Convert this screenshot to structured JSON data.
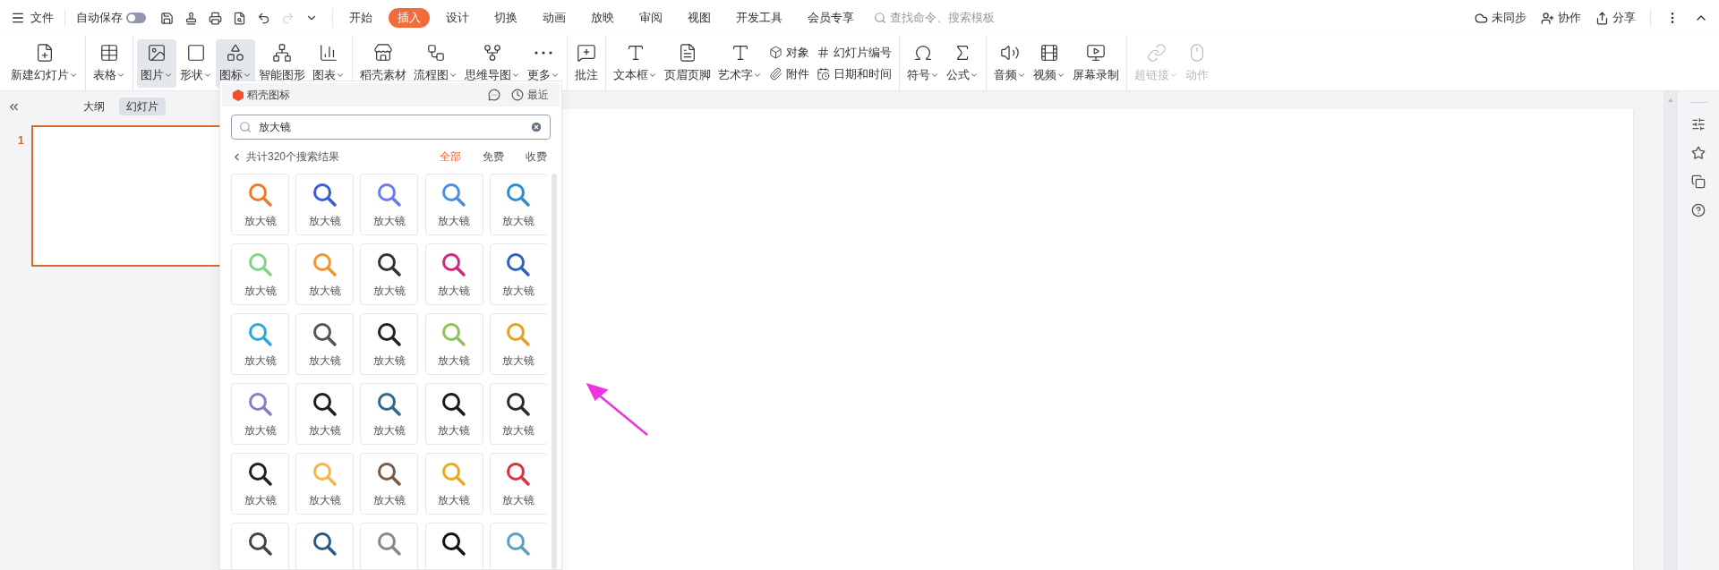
{
  "topbar": {
    "file_menu": "文件",
    "autosave": {
      "label": "自动保存",
      "on": false
    },
    "tabs": [
      {
        "label": "开始",
        "selected": false
      },
      {
        "label": "插入",
        "selected": true
      },
      {
        "label": "设计",
        "selected": false
      },
      {
        "label": "切换",
        "selected": false
      },
      {
        "label": "动画",
        "selected": false
      },
      {
        "label": "放映",
        "selected": false
      },
      {
        "label": "审阅",
        "selected": false
      },
      {
        "label": "视图",
        "selected": false
      },
      {
        "label": "开发工具",
        "selected": false
      },
      {
        "label": "会员专享",
        "selected": false
      }
    ],
    "search": {
      "placeholder": "查找命令、搜索模板"
    },
    "actions": [
      "未同步",
      "协作",
      "分享"
    ]
  },
  "ribbon": [
    {
      "items": [
        {
          "kind": "large",
          "label": "新建幻灯片",
          "caret": true,
          "selected": false,
          "disabled": false
        }
      ]
    },
    {
      "items": [
        {
          "kind": "large",
          "label": "表格",
          "caret": true,
          "selected": false,
          "disabled": false
        }
      ]
    },
    {
      "items": [
        {
          "kind": "large",
          "label": "图片",
          "caret": true,
          "selected": true,
          "disabled": false
        },
        {
          "kind": "large",
          "label": "形状",
          "caret": true,
          "selected": false,
          "disabled": false
        },
        {
          "kind": "large",
          "label": "图标",
          "caret": true,
          "selected": true,
          "disabled": false
        },
        {
          "kind": "large",
          "label": "智能图形",
          "caret": false,
          "selected": false,
          "disabled": false
        },
        {
          "kind": "large",
          "label": "图表",
          "caret": true,
          "selected": false,
          "disabled": false
        }
      ]
    },
    {
      "items": [
        {
          "kind": "large",
          "label": "稻壳素材",
          "caret": false,
          "selected": false,
          "disabled": false
        },
        {
          "kind": "large",
          "label": "流程图",
          "caret": true,
          "selected": false,
          "disabled": false
        },
        {
          "kind": "large",
          "label": "思维导图",
          "caret": true,
          "selected": false,
          "disabled": false
        },
        {
          "kind": "large",
          "label": "更多",
          "caret": true,
          "selected": false,
          "disabled": false
        }
      ]
    },
    {
      "items": [
        {
          "kind": "large",
          "label": "批注",
          "caret": false,
          "selected": false,
          "disabled": false
        }
      ]
    },
    {
      "items": [
        {
          "kind": "large",
          "label": "文本框",
          "caret": true,
          "selected": false,
          "disabled": false
        },
        {
          "kind": "large",
          "label": "页眉页脚",
          "caret": false,
          "selected": false,
          "disabled": false
        },
        {
          "kind": "large",
          "label": "艺术字",
          "caret": true,
          "selected": false,
          "disabled": false
        },
        {
          "kind": "small",
          "label": "对象",
          "selected": false,
          "disabled": false
        },
        {
          "kind": "small",
          "label": "附件",
          "selected": false,
          "disabled": false
        },
        {
          "kind": "small",
          "label": "幻灯片编号",
          "selected": false,
          "disabled": false
        },
        {
          "kind": "small",
          "label": "日期和时间",
          "selected": false,
          "disabled": false
        }
      ]
    },
    {
      "items": [
        {
          "kind": "large",
          "label": "符号",
          "caret": true,
          "selected": false,
          "disabled": false
        },
        {
          "kind": "large",
          "label": "公式",
          "caret": true,
          "selected": false,
          "disabled": false
        }
      ]
    },
    {
      "items": [
        {
          "kind": "large",
          "label": "音频",
          "caret": true,
          "selected": false,
          "disabled": false
        },
        {
          "kind": "large",
          "label": "视频",
          "caret": true,
          "selected": false,
          "disabled": false
        },
        {
          "kind": "large",
          "label": "屏幕录制",
          "caret": false,
          "selected": false,
          "disabled": false
        }
      ]
    },
    {
      "items": [
        {
          "kind": "large",
          "label": "超链接",
          "caret": true,
          "selected": false,
          "disabled": true
        },
        {
          "kind": "large",
          "label": "动作",
          "caret": false,
          "selected": false,
          "disabled": true
        }
      ]
    }
  ],
  "slides_panel": {
    "tabs": [
      {
        "label": "大纲",
        "selected": false
      },
      {
        "label": "幻灯片",
        "selected": true
      }
    ],
    "slides": [
      {
        "number": "1",
        "selected": true
      }
    ]
  },
  "icon_panel": {
    "title": "稻壳图标",
    "recent": "最近",
    "search_value": "放大镜",
    "result_count": "共计320个搜索结果",
    "filters": [
      {
        "label": "全部",
        "selected": true
      },
      {
        "label": "免费",
        "selected": false
      },
      {
        "label": "收费",
        "selected": false
      }
    ],
    "icons": [
      {
        "label": "放大镜",
        "color": "#f07a2a"
      },
      {
        "label": "放大镜",
        "color": "#3a5bd9"
      },
      {
        "label": "放大镜",
        "color": "#6a7cf0"
      },
      {
        "label": "放大镜",
        "color": "#4a90e2"
      },
      {
        "label": "放大镜",
        "color": "#2a8fd0"
      },
      {
        "label": "放大镜",
        "color": "#7ed58a"
      },
      {
        "label": "放大镜",
        "color": "#f0962a"
      },
      {
        "label": "放大镜",
        "color": "#333333"
      },
      {
        "label": "放大镜",
        "color": "#d0287a"
      },
      {
        "label": "放大镜",
        "color": "#2f5fc0"
      },
      {
        "label": "放大镜",
        "color": "#29a8e0"
      },
      {
        "label": "放大镜",
        "color": "#555555"
      },
      {
        "label": "放大镜",
        "color": "#222222"
      },
      {
        "label": "放大镜",
        "color": "#8cc45a"
      },
      {
        "label": "放大镜",
        "color": "#e8a020"
      },
      {
        "label": "放大镜",
        "color": "#8a7cc8"
      },
      {
        "label": "放大镜",
        "color": "#1e1e1e"
      },
      {
        "label": "放大镜",
        "color": "#2a6a90"
      },
      {
        "label": "放大镜",
        "color": "#1a1a1a"
      },
      {
        "label": "放大镜",
        "color": "#2a2a2a"
      },
      {
        "label": "放大镜",
        "color": "#202020"
      },
      {
        "label": "放大镜",
        "color": "#f5b642"
      },
      {
        "label": "放大镜",
        "color": "#7a5a40"
      },
      {
        "label": "放大镜",
        "color": "#f0a818"
      },
      {
        "label": "放大镜",
        "color": "#e03040"
      },
      {
        "color": "#444444"
      },
      {
        "color": "#2e5a80"
      },
      {
        "color": "#888888"
      },
      {
        "color": "#111111"
      },
      {
        "color": "#5aa0c0"
      }
    ]
  }
}
